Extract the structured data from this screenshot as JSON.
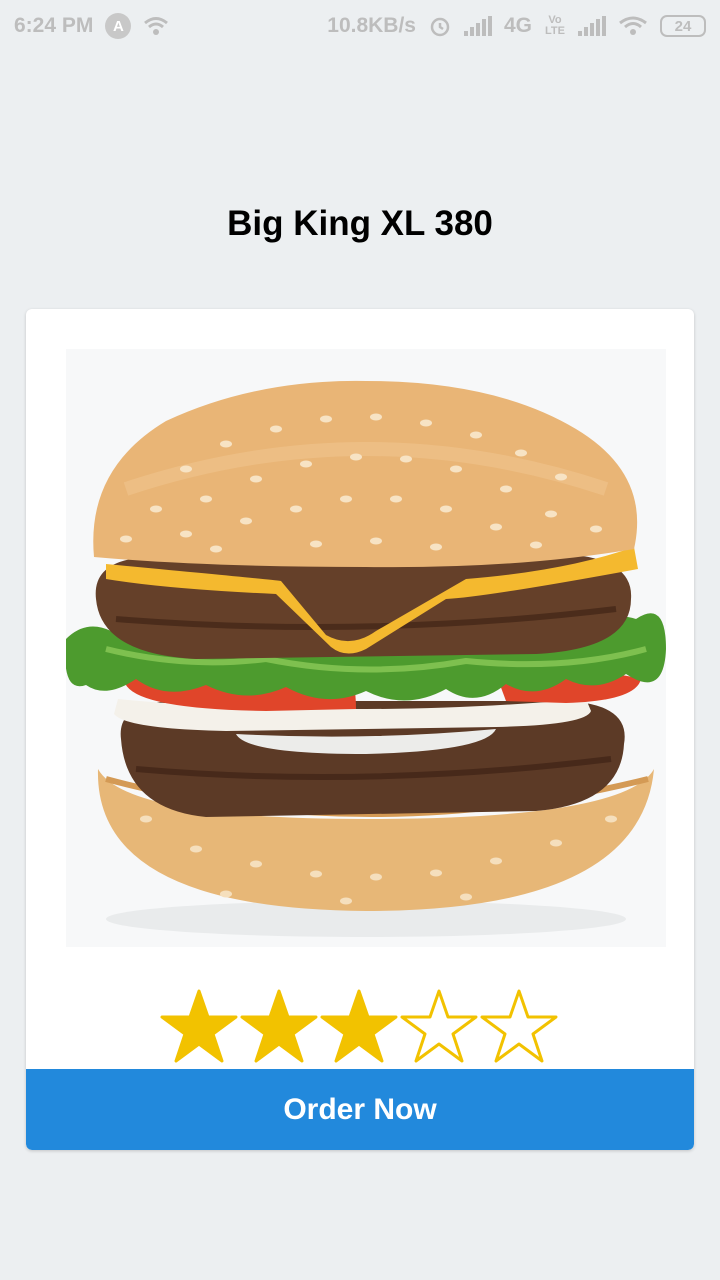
{
  "status_bar": {
    "time": "6:24 PM",
    "app_badge": "A",
    "speed": "10.8KB/s",
    "network": "4G",
    "volte": "Vo LTE",
    "battery": "24"
  },
  "product": {
    "title": "Big King XL 380",
    "image_icon": "burger-image",
    "rating": 3,
    "rating_max": 5
  },
  "actions": {
    "order_label": "Order Now"
  },
  "colors": {
    "background": "#ECEFF1",
    "card": "#FFFFFF",
    "button": "#2289DC",
    "star": "#F2C200"
  }
}
